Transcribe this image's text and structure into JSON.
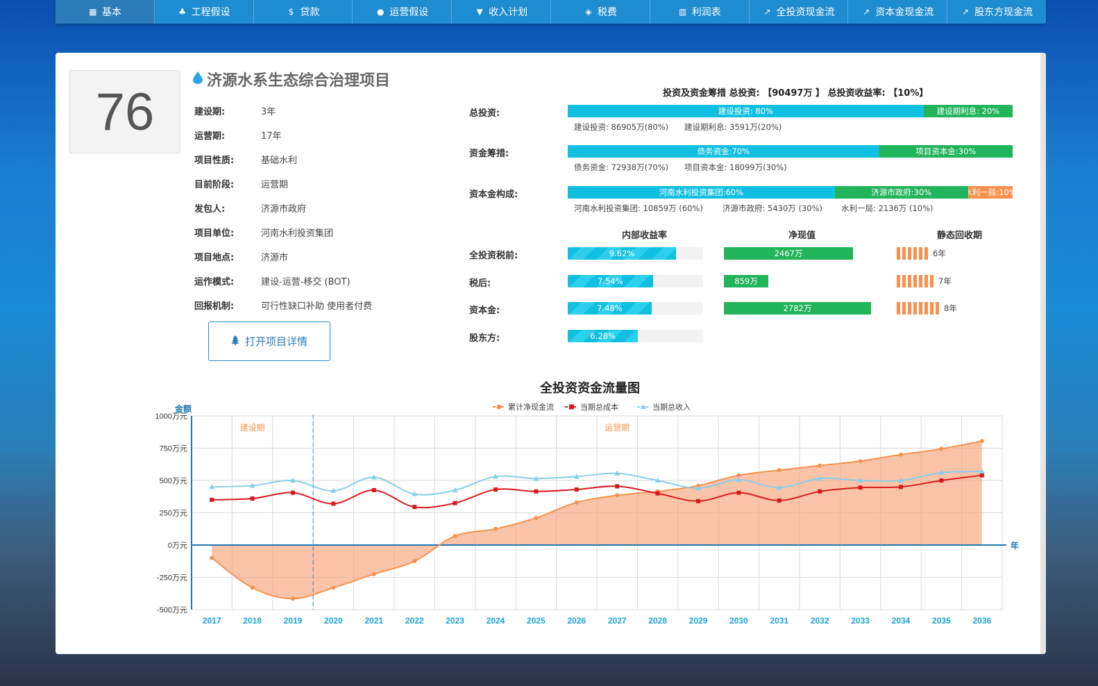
{
  "nav": {
    "items": [
      {
        "label": "基本",
        "icon": "calendar-icon",
        "glyph": "▦"
      },
      {
        "label": "工程假设",
        "icon": "tree-icon",
        "glyph": "♣"
      },
      {
        "label": "贷款",
        "icon": "dollar-icon",
        "glyph": "$"
      },
      {
        "label": "运营假设",
        "icon": "drop-icon",
        "glyph": "●"
      },
      {
        "label": "收入计划",
        "icon": "filter-icon",
        "glyph": "▼"
      },
      {
        "label": "税费",
        "icon": "tag-icon",
        "glyph": "◈"
      },
      {
        "label": "利润表",
        "icon": "bar-chart-icon",
        "glyph": "▥"
      },
      {
        "label": "全投资现金流",
        "icon": "line-chart-icon",
        "glyph": "↗"
      },
      {
        "label": "资本金现金流",
        "icon": "line-chart-icon",
        "glyph": "↗"
      },
      {
        "label": "股东方现金流",
        "icon": "line-chart-icon",
        "glyph": "↗"
      }
    ]
  },
  "project": {
    "score": "76",
    "title": "济源水系生态综合治理项目",
    "fields": [
      {
        "label": "建设期:",
        "value": "3年"
      },
      {
        "label": "运营期:",
        "value": "17年"
      },
      {
        "label": "项目性质:",
        "value": "基础水利"
      },
      {
        "label": "目前阶段:",
        "value": "运营期"
      },
      {
        "label": "发包人:",
        "value": "济源市政府"
      },
      {
        "label": "项目单位:",
        "value": "河南水利投资集团"
      },
      {
        "label": "项目地点:",
        "value": "济源市"
      },
      {
        "label": "运作模式:",
        "value": "建设-运营-移交 (BOT)"
      },
      {
        "label": "回报机制:",
        "value": "可行性缺口补助 使用者付费"
      }
    ],
    "open_button": "打开项目详情"
  },
  "summary": {
    "line": "投资及资金筹措 总投资: 【90497万 】 总投资收益率: 【10%】"
  },
  "bars": {
    "total": {
      "label": "总投资:",
      "segments": [
        {
          "text": "建设投资: 80%",
          "share": 0.8,
          "color": "#11bfe0"
        },
        {
          "text": "建设期利息: 20%",
          "share": 0.2,
          "color": "#22b45a"
        }
      ],
      "notes": [
        "建设投资: 86905万(80%)",
        "建设期利息: 3591万(20%)"
      ]
    },
    "funding": {
      "label": "资金筹措:",
      "segments": [
        {
          "text": "债务资金:70%",
          "share": 0.7,
          "color": "#11bfe0"
        },
        {
          "text": "项目资本金:30%",
          "share": 0.3,
          "color": "#22b45a"
        }
      ],
      "notes": [
        "债务资金: 72938万(70%)",
        "项目资本金: 18099万(30%)"
      ]
    },
    "equity": {
      "label": "资本金构成:",
      "segments": [
        {
          "text": "河南水利投资集团:60%",
          "share": 0.6,
          "color": "#11bfe0"
        },
        {
          "text": "济源市政府:30%",
          "share": 0.3,
          "color": "#22b45a"
        },
        {
          "text": "水利一局:10%",
          "share": 0.1,
          "color": "#f7914d"
        }
      ],
      "notes": [
        "河南水利投资集团: 10859万 (60%)",
        "济源市政府: 5430万 (30%)",
        "水利一局: 2136万 (10%)"
      ]
    }
  },
  "metrics": {
    "headers": {
      "irr": "内部收益率",
      "npv": "净现值",
      "payback": "静态回收期"
    },
    "rows": [
      {
        "label": "全投资税前:",
        "irr": "9.62%",
        "irr_level": 0.8,
        "npv": "2467万",
        "npv_level": 0.73,
        "payback": "6年",
        "payback_segments": 6
      },
      {
        "label": "税后:",
        "irr": "7.54%",
        "irr_level": 0.63,
        "npv": "859万",
        "npv_level": 0.25,
        "payback": "7年",
        "payback_segments": 7
      },
      {
        "label": "资本金:",
        "irr": "7.48%",
        "irr_level": 0.62,
        "npv": "2782万",
        "npv_level": 0.83,
        "payback": "8年",
        "payback_segments": 8
      },
      {
        "label": "股东方:",
        "irr": "6.28%",
        "irr_level": 0.52
      }
    ]
  },
  "chart_data": {
    "type": "line",
    "title": "全投资资金流量图",
    "ylabel": "金额",
    "xlabel": "年",
    "ylim": [
      -500,
      1000
    ],
    "yticks": [
      "1000万元",
      "750万元",
      "500万元",
      "250万元",
      "0万元",
      "-250万元",
      "-500万元"
    ],
    "categories": [
      "2017",
      "2018",
      "2019",
      "2020",
      "2021",
      "2022",
      "2023",
      "2024",
      "2025",
      "2026",
      "2027",
      "2028",
      "2029",
      "2030",
      "2031",
      "2032",
      "2033",
      "2034",
      "2035",
      "2036"
    ],
    "legend_position": "top-center",
    "annotations": [
      "建设期",
      "运营期"
    ],
    "series": [
      {
        "name": "累计净现金流",
        "color": "#f7914d",
        "marker": "circle",
        "area": true,
        "values": [
          -100,
          -330,
          -415,
          -330,
          -225,
          -125,
          70,
          125,
          210,
          330,
          385,
          415,
          460,
          540,
          580,
          615,
          650,
          700,
          745,
          805
        ]
      },
      {
        "name": "当期总成本",
        "color": "#d7191c",
        "marker": "square",
        "values": [
          350,
          360,
          405,
          320,
          425,
          295,
          325,
          430,
          415,
          430,
          455,
          400,
          340,
          405,
          345,
          415,
          445,
          450,
          500,
          540
        ]
      },
      {
        "name": "当期总收入",
        "color": "#87ceeb",
        "marker": "triangle",
        "values": [
          450,
          460,
          500,
          420,
          525,
          395,
          425,
          530,
          515,
          530,
          555,
          500,
          440,
          505,
          445,
          515,
          500,
          500,
          560,
          570
        ]
      }
    ]
  }
}
